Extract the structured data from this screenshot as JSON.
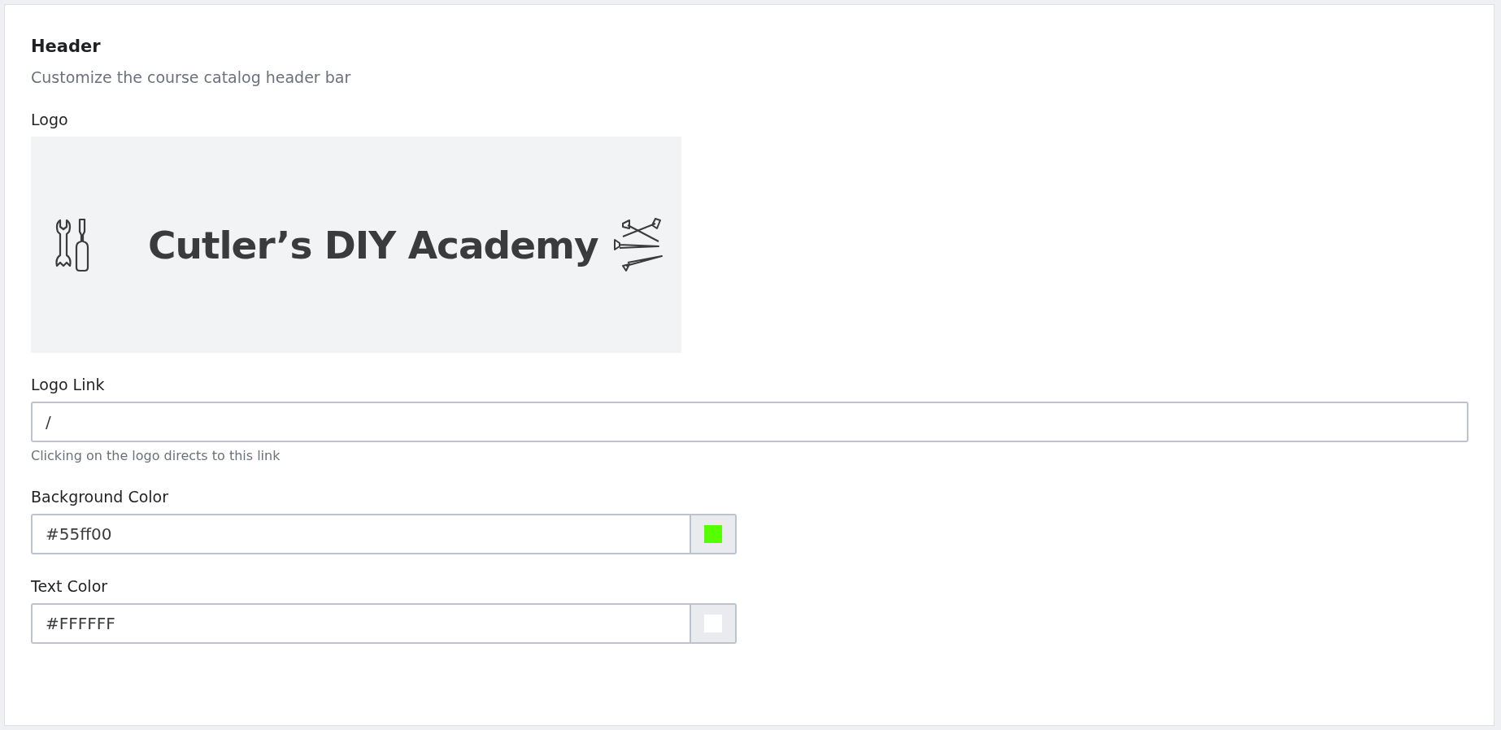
{
  "section": {
    "title": "Header",
    "subtitle": "Customize the course catalog header bar"
  },
  "logo": {
    "label": "Logo",
    "text": "Cutler’s DIY Academy"
  },
  "fields": [
    {
      "kind": "text",
      "label": "Logo Link",
      "value": "/",
      "hint": "Clicking on the logo directs to this link"
    },
    {
      "kind": "color",
      "label": "Background Color",
      "value": "#55ff00",
      "color": "#55ff00"
    },
    {
      "kind": "color",
      "label": "Text Color",
      "value": "#FFFFFF",
      "color": "#ffffff"
    }
  ]
}
